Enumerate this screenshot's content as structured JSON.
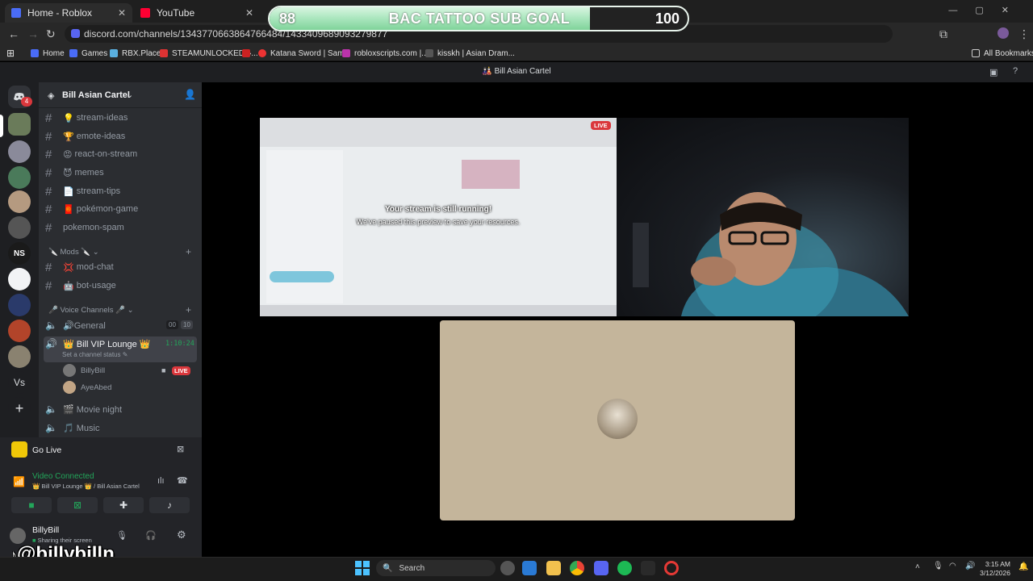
{
  "browser": {
    "tabs": [
      {
        "title": "Home - Roblox"
      },
      {
        "title": "YouTube"
      }
    ],
    "url": "discord.com/channels/1343770663864766484/1433409689093279877",
    "bookmarks": [
      "Home",
      "Games",
      "RBX.Place",
      "STEAMUNLOCKED »...",
      "Katana Sword | Sam...",
      "robloxscripts.com |...",
      "kisskh | Asian Dram..."
    ],
    "all_bookmarks": "All Bookmarks"
  },
  "overlay": {
    "current": "88",
    "title": "BAC TATTOO SUB GOAL",
    "goal": "100",
    "progress_fraction": 0.88,
    "watermark": "@billybilln"
  },
  "discord": {
    "window_title": "Bill Asian Cartel",
    "rail_badge": "4",
    "server_name": "Bill Asian Cartel",
    "channels": [
      {
        "emoji": "💡",
        "name": "stream-ideas"
      },
      {
        "emoji": "🏆",
        "name": "emote-ideas"
      },
      {
        "emoji": "😡",
        "name": "react-on-stream"
      },
      {
        "emoji": "😈",
        "name": "memes"
      },
      {
        "emoji": "📄",
        "name": "stream-tips"
      },
      {
        "emoji": "🧧",
        "name": "pokémon-game"
      },
      {
        "emoji": "",
        "name": "pokemon-spam"
      }
    ],
    "mods_category": "🔪 Mods 🔪",
    "mod_channels": [
      {
        "emoji": "💢",
        "name": "mod-chat"
      },
      {
        "emoji": "🤖",
        "name": "bot-usage"
      }
    ],
    "voice_category": "🎤 Voice Channels 🎤",
    "voice_channels": {
      "general": {
        "name": "🔊General",
        "count_a": "00",
        "count_b": "10"
      },
      "vip": {
        "name": "👑 Bill VIP Lounge 👑",
        "timer": "1:10:24",
        "status": "Set a channel status"
      },
      "users": [
        {
          "name": "BillyBill",
          "badge": "LIVE"
        },
        {
          "name": "AyeAbed"
        }
      ],
      "movie": "🎬 Movie night",
      "music": "🎵 Music"
    },
    "go_live": "Go Live",
    "video_connected": "Video Connected",
    "connection_location": "👑 Bill VIP Lounge 👑 / Bill Asian Cartel",
    "user": {
      "name": "BillyBill",
      "status": "Sharing their screen"
    },
    "stream": {
      "live_badge": "LIVE",
      "paused_title": "Your stream is still running!",
      "paused_sub": "We've paused this preview to save your resources."
    }
  },
  "taskbar": {
    "search": "Search",
    "time": "3:15 AM",
    "date": "3/12/2026"
  },
  "colors": {
    "discord_bg": "#313338",
    "sidebar": "#2b2d31",
    "rail": "#1e1f22",
    "live_red": "#da373c",
    "green": "#23a55a",
    "goal_fill": "#a9e6bd"
  }
}
